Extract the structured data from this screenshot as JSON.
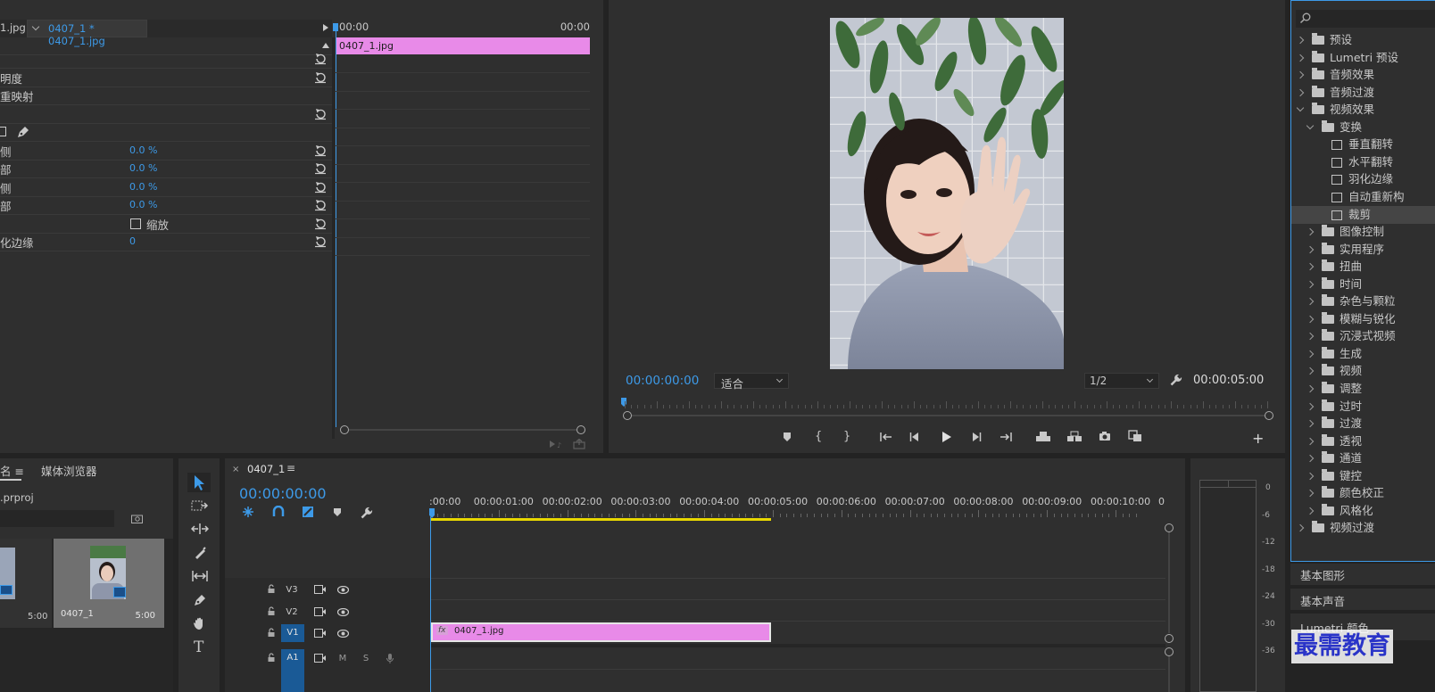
{
  "effect_controls": {
    "source_tab_label": "1.jpg",
    "clip_tab_label": "0407_1 * 0407_1.jpg",
    "timecode_start": "00:00",
    "timecode_end": "00:00",
    "clip_bar_label": "0407_1.jpg",
    "rows": [
      {
        "label": "",
        "value": ""
      },
      {
        "label": "明度",
        "value": ""
      },
      {
        "label": "重映射",
        "value": ""
      },
      {
        "label": "",
        "value": ""
      },
      {
        "label": "",
        "value": ""
      },
      {
        "label": "侧",
        "value": "0.0 %"
      },
      {
        "label": "部",
        "value": "0.0 %"
      },
      {
        "label": "侧",
        "value": "0.0 %"
      },
      {
        "label": "部",
        "value": "0.0 %"
      },
      {
        "label": "",
        "value": "缩放"
      },
      {
        "label": "化边缘",
        "value": "0"
      }
    ]
  },
  "program_monitor": {
    "timecode_current": "00:00:00:00",
    "fit_label": "适合",
    "resolution_label": "1/2",
    "timecode_duration": "00:00:05:00"
  },
  "effects_panel": {
    "items": [
      {
        "label": "预设",
        "indent": 0,
        "kind": "folder-special",
        "open": false
      },
      {
        "label": "Lumetri 预设",
        "indent": 0,
        "kind": "folder-special",
        "open": false
      },
      {
        "label": "音频效果",
        "indent": 0,
        "kind": "folder",
        "open": false
      },
      {
        "label": "音频过渡",
        "indent": 0,
        "kind": "folder",
        "open": false
      },
      {
        "label": "视频效果",
        "indent": 0,
        "kind": "folder",
        "open": true
      },
      {
        "label": "变换",
        "indent": 1,
        "kind": "folder",
        "open": true
      },
      {
        "label": "垂直翻转",
        "indent": 2,
        "kind": "effect",
        "open": false
      },
      {
        "label": "水平翻转",
        "indent": 2,
        "kind": "effect",
        "open": false
      },
      {
        "label": "羽化边缘",
        "indent": 2,
        "kind": "effect",
        "open": false
      },
      {
        "label": "自动重新构",
        "indent": 2,
        "kind": "effect",
        "open": false
      },
      {
        "label": "裁剪",
        "indent": 2,
        "kind": "effect",
        "open": false,
        "selected": true
      },
      {
        "label": "图像控制",
        "indent": 1,
        "kind": "folder",
        "open": false
      },
      {
        "label": "实用程序",
        "indent": 1,
        "kind": "folder",
        "open": false
      },
      {
        "label": "扭曲",
        "indent": 1,
        "kind": "folder",
        "open": false
      },
      {
        "label": "时间",
        "indent": 1,
        "kind": "folder",
        "open": false
      },
      {
        "label": "杂色与颗粒",
        "indent": 1,
        "kind": "folder",
        "open": false
      },
      {
        "label": "模糊与锐化",
        "indent": 1,
        "kind": "folder",
        "open": false
      },
      {
        "label": "沉浸式视频",
        "indent": 1,
        "kind": "folder",
        "open": false
      },
      {
        "label": "生成",
        "indent": 1,
        "kind": "folder",
        "open": false
      },
      {
        "label": "视频",
        "indent": 1,
        "kind": "folder",
        "open": false
      },
      {
        "label": "调整",
        "indent": 1,
        "kind": "folder",
        "open": false
      },
      {
        "label": "过时",
        "indent": 1,
        "kind": "folder",
        "open": false
      },
      {
        "label": "过渡",
        "indent": 1,
        "kind": "folder",
        "open": false
      },
      {
        "label": "透视",
        "indent": 1,
        "kind": "folder",
        "open": false
      },
      {
        "label": "通道",
        "indent": 1,
        "kind": "folder",
        "open": false
      },
      {
        "label": "键控",
        "indent": 1,
        "kind": "folder",
        "open": false
      },
      {
        "label": "颜色校正",
        "indent": 1,
        "kind": "folder",
        "open": false
      },
      {
        "label": "风格化",
        "indent": 1,
        "kind": "folder",
        "open": false
      },
      {
        "label": "视频过渡",
        "indent": 0,
        "kind": "folder",
        "open": false
      }
    ],
    "basic_graphics": "基本图形",
    "basic_sound": "基本声音",
    "lumetri_color": "Lumetri 颜色"
  },
  "project_panel": {
    "tab_name": "名",
    "media_browser_tab": "媒体浏览器",
    "project_file": ".prproj",
    "thumb1_duration": "5:00",
    "thumb2_name": "0407_1",
    "thumb2_duration": "5:00"
  },
  "timeline": {
    "sequence_tab": "0407_1",
    "timecode": "00:00:00:00",
    "ruler_labels": [
      ":00:00",
      "00:00:01:00",
      "00:00:02:00",
      "00:00:03:00",
      "00:00:04:00",
      "00:00:05:00",
      "00:00:06:00",
      "00:00:07:00",
      "00:00:08:00",
      "00:00:09:00",
      "00:00:10:00",
      "0"
    ],
    "tracks": {
      "v3": "V3",
      "v2": "V2",
      "v1": "V1",
      "a1": "A1",
      "m": "M",
      "s": "S"
    },
    "clip_label": "0407_1.jpg",
    "clip_fx": "fx"
  },
  "audio_meter": {
    "scale": [
      "0",
      "-6",
      "-12",
      "-18",
      "-24",
      "-30",
      "-36"
    ]
  },
  "watermark": "最需教育",
  "colors": {
    "accent": "#3d9ae8",
    "clip_pink": "#e88ae8",
    "panel_bg": "#2f2f2f",
    "frame_bg": "#232323",
    "work_area": "#e8d700"
  }
}
